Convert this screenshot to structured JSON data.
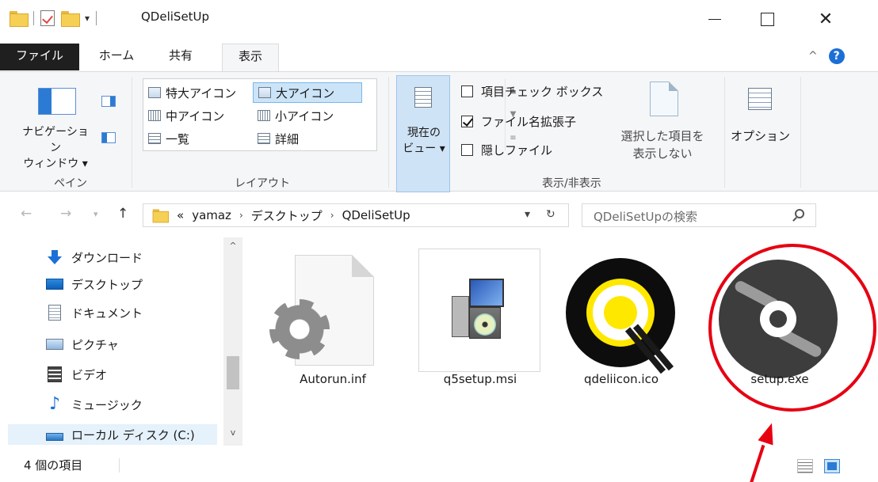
{
  "window": {
    "title": "QDeliSetUp"
  },
  "tabs": {
    "file": "ファイル",
    "home": "ホーム",
    "share": "共有",
    "view": "表示"
  },
  "ribbon": {
    "pane": {
      "nav_pane_line1": "ナビゲーション",
      "nav_pane_line2": "ウィンドウ ▾",
      "group_label": "ペイン"
    },
    "layout": {
      "items": [
        "特大アイコン",
        "大アイコン",
        "中アイコン",
        "小アイコン",
        "一覧",
        "詳細"
      ],
      "selected": "大アイコン",
      "group_label": "レイアウト"
    },
    "current_view": {
      "line1": "現在の",
      "line2": "ビュー ▾"
    },
    "show_hide": {
      "item_checkboxes": "項目チェック ボックス",
      "item_checkboxes_checked": false,
      "file_extensions": "ファイル名拡張子",
      "file_extensions_checked": true,
      "hidden_files": "隠しファイル",
      "hidden_files_checked": false,
      "hide_selected_line1": "選択した項目を",
      "hide_selected_line2": "表示しない",
      "group_label": "表示/非表示"
    },
    "options_label": "オプション"
  },
  "address": {
    "overflow": "«",
    "crumbs": [
      "yamaz",
      "デスクトップ",
      "QDeliSetUp"
    ],
    "separator": "›",
    "search_placeholder": "QDeliSetUpの検索"
  },
  "nav_pane": {
    "items": [
      "ダウンロード",
      "デスクトップ",
      "ドキュメント",
      "ピクチャ",
      "ビデオ",
      "ミュージック",
      "ローカル ディスク (C:)"
    ]
  },
  "files": [
    {
      "name": "Autorun.inf",
      "icon": "settings-file-icon"
    },
    {
      "name": "q5setup.msi",
      "icon": "installer-icon"
    },
    {
      "name": "qdeliicon.ico",
      "icon": "qdeli-logo-icon"
    },
    {
      "name": "setup.exe",
      "icon": "cd-disc-icon"
    }
  ],
  "status": {
    "count": "4 個の項目"
  },
  "colors": {
    "accent": "#1c6fd6",
    "annotation": "#e60012",
    "selected_bg": "#cce4f7"
  }
}
